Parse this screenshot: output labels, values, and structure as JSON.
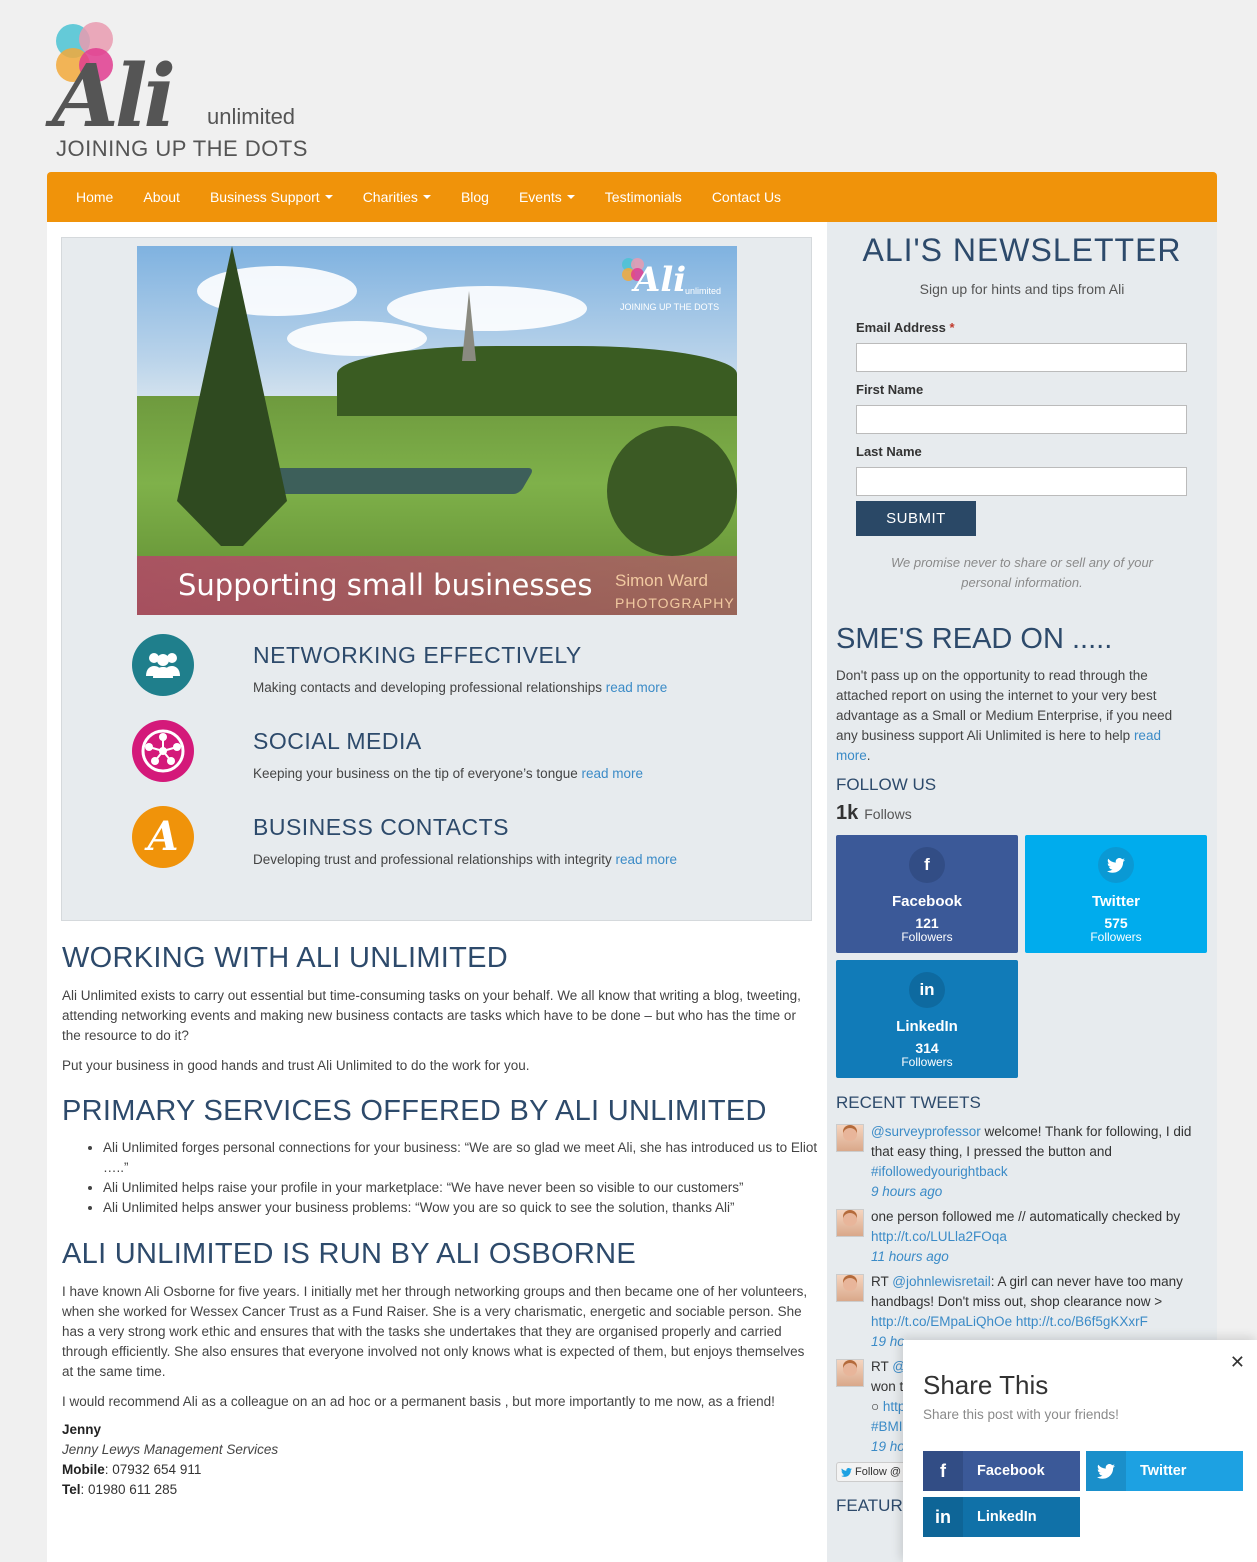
{
  "logo": {
    "name": "Ali",
    "suffix": "unlimited",
    "tagline": "JOINING UP THE DOTS",
    "dot_colors": [
      "#4bc3d4",
      "#f0627f",
      "#f2a93b",
      "#e03c8f"
    ]
  },
  "nav": {
    "items": [
      {
        "label": "Home",
        "dropdown": false
      },
      {
        "label": "About",
        "dropdown": false
      },
      {
        "label": "Business Support",
        "dropdown": true
      },
      {
        "label": "Charities",
        "dropdown": true
      },
      {
        "label": "Blog",
        "dropdown": false
      },
      {
        "label": "Events",
        "dropdown": true
      },
      {
        "label": "Testimonials",
        "dropdown": false
      },
      {
        "label": "Contact Us",
        "dropdown": false
      }
    ],
    "color": "#f0930a"
  },
  "hero": {
    "banner_text": "Supporting small businesses",
    "photographer_line1": "Simon Ward",
    "photographer_line2": "PHOTOGRAPHY",
    "mini_logo_name": "Ali",
    "mini_logo_suffix": "unlimited",
    "mini_logo_tagline": "JOINING UP THE DOTS"
  },
  "services": [
    {
      "title": "NETWORKING EFFECTIVELY",
      "text": "Making contacts and developing professional relationships",
      "link": "read more",
      "icon": "people-group-icon",
      "color": "#1f7f8c"
    },
    {
      "title": "SOCIAL MEDIA",
      "text": "Keeping your business on the tip of everyone’s tongue",
      "link": "read more",
      "icon": "social-network-icon",
      "color": "#d4197a"
    },
    {
      "title": "BUSINESS CONTACTS",
      "text": "Developing trust and professional relationships with integrity",
      "link": "read more",
      "icon": "ali-logo-icon",
      "color": "#f0930a"
    }
  ],
  "content": {
    "h_working": "WORKING WITH ALI UNLIMITED",
    "p_working_1": "Ali Unlimited exists to carry out essential but time-consuming tasks on your behalf.  We all know that writing a blog, tweeting, attending networking events and making new business contacts are tasks which have to be done – but who has the time or the resource to do it?",
    "p_working_2": "Put your business in good hands and trust Ali Unlimited to do the work for you.",
    "h_primary": "PRIMARY SERVICES OFFERED BY ALI UNLIMITED",
    "bullets": [
      "Ali Unlimited forges personal connections for your business: “We are so glad we meet Ali, she has introduced us to Eliot …..”",
      "Ali Unlimited helps raise your profile in your marketplace: “We have never been so visible to our customers”",
      "Ali Unlimited helps answer your business problems: “Wow you are so quick to see the solution, thanks Ali”"
    ],
    "h_run": "ALI UNLIMITED IS RUN BY ALI OSBORNE",
    "p_run_1": "I have known Ali Osborne for five years.  I initially met her through networking groups and then became one of her volunteers, when she worked for Wessex Cancer Trust as a Fund Raiser.  She is a very charismatic, energetic and sociable person.  She has a very strong work ethic and ensures that with the tasks she undertakes that they are organised properly and carried through efficiently.  She also ensures  that everyone involved not only knows what is expected of them, but enjoys themselves at the same time.",
    "p_run_2": "I would recommend Ali as a colleague on an ad hoc or a permanent basis , but more importantly to me now, as a friend!",
    "sig_name": "Jenny",
    "sig_company": "Jenny Lewys Management Services",
    "sig_mobile_label": "Mobile",
    "sig_mobile": ": 07932 654 911",
    "sig_tel_label": "Tel",
    "sig_tel": ": 01980 611 285"
  },
  "newsletter": {
    "title": "ALI'S NEWSLETTER",
    "subtitle": "Sign up for hints and tips from Ali",
    "email_label": "Email Address",
    "required_mark": "*",
    "first_label": "First Name",
    "last_label": "Last Name",
    "email_value": "",
    "first_value": "",
    "last_value": "",
    "submit": "SUBMIT",
    "promise": "We promise never to share or sell any of your personal information."
  },
  "sme": {
    "title": "SME'S READ ON .....",
    "text": "Don't pass up on the opportunity to read through the attached report on using the internet to your very best advantage as a Small or Medium Enterprise, if you need any business support Ali Unlimited is here to help",
    "link": "read more",
    "link_end": "."
  },
  "follow": {
    "title": "FOLLOW US",
    "total": "1k",
    "total_label": "Follows",
    "networks": [
      {
        "name": "Facebook",
        "count": "121",
        "label": "Followers",
        "glyph": "f",
        "color": "#3b5998",
        "icon": "facebook-icon"
      },
      {
        "name": "Twitter",
        "count": "575",
        "label": "Followers",
        "glyph": "🐦",
        "color": "#00aced",
        "icon": "twitter-icon"
      },
      {
        "name": "LinkedIn",
        "count": "314",
        "label": "Followers",
        "glyph": "in",
        "color": "#117bb8",
        "icon": "linkedin-icon"
      }
    ]
  },
  "tweets": {
    "title": "RECENT TWEETS",
    "items": [
      {
        "handle": "@surveyprofessor",
        "text": " welcome! Thank for following, I did that easy thing, I pressed the button and ",
        "tag": "#ifollowedyourightback",
        "time": "9 hours ago"
      },
      {
        "pre": "one person followed me // automatically checked by ",
        "link": "http://t.co/LULla2FOqa",
        "time": "11 hours ago"
      },
      {
        "pre": "RT ",
        "handle": "@johnlewisretail",
        "text": ": A girl can never have too many handbags! Don't miss out, shop clearance now > ",
        "link": "http://t.co/EMpaLiQhOe",
        "link2": "http://t.co/B6f5gKXxrF",
        "time": "19 ho"
      },
      {
        "pre": "RT ",
        "handle": "@v",
        "line2": "won t",
        "line3_pre": "○ ",
        "line3_link": "http",
        "tag": "#BMI",
        "time": "19 ho"
      }
    ],
    "follow_button": "Follow @"
  },
  "featured": "FEATURE",
  "share": {
    "close": "✕",
    "title": "Share This",
    "subtitle": "Share this post with your friends!",
    "buttons": [
      {
        "label": "Facebook",
        "glyph": "f",
        "color": "#3b5998",
        "icon_bg": "#324d85"
      },
      {
        "label": "Twitter",
        "glyph": "🐦",
        "color": "#1da1e2",
        "icon_bg": "#1a8fca"
      },
      {
        "label": "LinkedIn",
        "glyph": "in",
        "color": "#1071a8",
        "icon_bg": "#0e6597"
      }
    ]
  }
}
